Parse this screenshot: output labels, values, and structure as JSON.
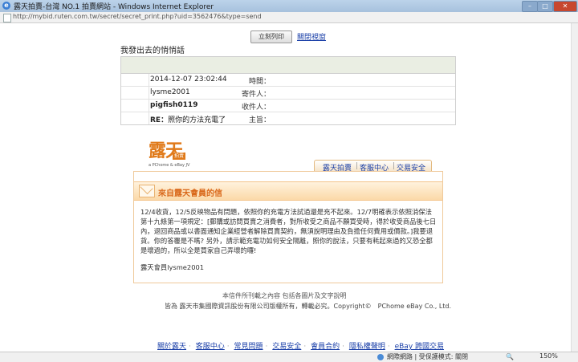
{
  "window": {
    "title": "露天拍賣-台灣 NO.1 拍賣網站 - Windows Internet Explorer",
    "min": "–",
    "max": "□",
    "close": "✕"
  },
  "address": {
    "url": "http://mybid.ruten.com.tw/secret/secret_print.php?uid=3562476&type=send"
  },
  "actions": {
    "print_label": "立刻列印",
    "close_label": "關閉視窗"
  },
  "page_title": "我發出去的悄悄話",
  "meta": {
    "time_label": "時間：",
    "time_value": "2014-12-07 23:02:44",
    "sender_label": "寄件人：",
    "sender_value": "lysme2001",
    "recipient_label": "收件人：",
    "recipient_value": "pigfish0119",
    "subject_label": "主旨：",
    "subject_prefix": "RE：",
    "subject_value": "照你的方法充電了"
  },
  "logo": {
    "mark": "露天",
    "badge": "拍賣",
    "sub": "a PChome & eBay JV"
  },
  "tabs": [
    "露天拍賣",
    "客服中心",
    "交易安全"
  ],
  "card": {
    "title": "來自露天會員的信",
    "body": "12/4收貨，12/5反映物品有問題，依照你的充電方法試過還是充不起來。12/7明確表示依照消保法第十九條第一項規定：[郵購或訪問買賣之消費者，對所收受之商品不願買受時，得於收受商品後七日內，退回商品或以書面通知企業經營者解除買賣契約，無須說明理由及負擔任何費用或價款。]我要退貨。你的答覆是不嗎? 另外，請示範充電功如何安全隔離，照你的說法，只要有耗起來過的又恐全都是壞過的，所以全是買家自己弄壞的囉!",
    "signature": "露天會員lysme2001"
  },
  "footer": {
    "line1": "本信件所刊載之內容 包括各圖片及文字說明",
    "line2": "皆為 露天市集國際資訊股份有限公司版權所有，轉載必究。Copyright©　PChome eBay Co., Ltd.",
    "links": [
      "關於露天",
      "客服中心",
      "常見問題",
      "交易安全",
      "會員合約",
      "隱私權聲明",
      "eBay 跨國交易"
    ]
  },
  "status": {
    "zone": "網際網路 | 受保護模式: 關閉",
    "zoom": "150%"
  }
}
